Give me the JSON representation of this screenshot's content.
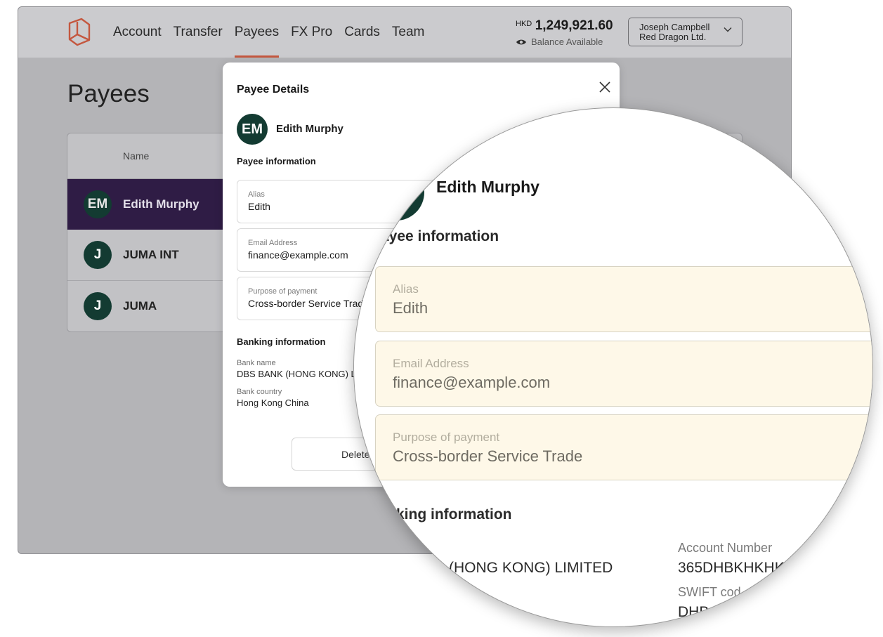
{
  "nav": {
    "items": [
      "Account",
      "Transfer",
      "Payees",
      "FX Pro",
      "Cards",
      "Team"
    ],
    "active": "Payees"
  },
  "balance": {
    "currency": "HKD",
    "amount": "1,249,921.60",
    "label": "Balance Available"
  },
  "user": {
    "name": "Joseph Campbell",
    "company": "Red Dragon Ltd."
  },
  "page": {
    "title": "Payees"
  },
  "table": {
    "header_name": "Name",
    "rows": [
      {
        "initials": "EM",
        "name": "Edith Murphy",
        "selected": true
      },
      {
        "initials": "J",
        "name": "JUMA INT",
        "selected": false
      },
      {
        "initials": "J",
        "name": "JUMA",
        "selected": false
      }
    ]
  },
  "modal": {
    "title": "Payee Details",
    "payee_initials": "EM",
    "payee_name": "Edith Murphy",
    "payee_section": "Payee information",
    "fields": [
      {
        "label": "Alias",
        "value": "Edith"
      },
      {
        "label": "Email Address",
        "value": "finance@example.com"
      },
      {
        "label": "Purpose of payment",
        "value": "Cross-border Service Trade"
      }
    ],
    "banking_section": "Banking information",
    "bank_name_label": "Bank name",
    "bank_name": "DBS BANK (HONG KONG) LIMITED",
    "bank_country_label": "Bank country",
    "bank_country": "Hong Kong China",
    "delete_label": "Delete"
  },
  "magnifier": {
    "payee_name": "Edith Murphy",
    "payee_section_partial": "ayee information",
    "banking_section_partial": "king information",
    "bank_name_label_partial": "e",
    "bank_name_partial": "(HONG KONG) LIMITED",
    "account_number_label": "Account Number",
    "account_number_partial": "365DHBKHKHK",
    "swift_label_partial": "SWIFT cod",
    "swift_value_partial": "DHB"
  },
  "colors": {
    "accent": "#c4573f",
    "selected_row": "#2f1c45",
    "avatar": "#133b32",
    "highlight_field": "#fef8e8"
  }
}
